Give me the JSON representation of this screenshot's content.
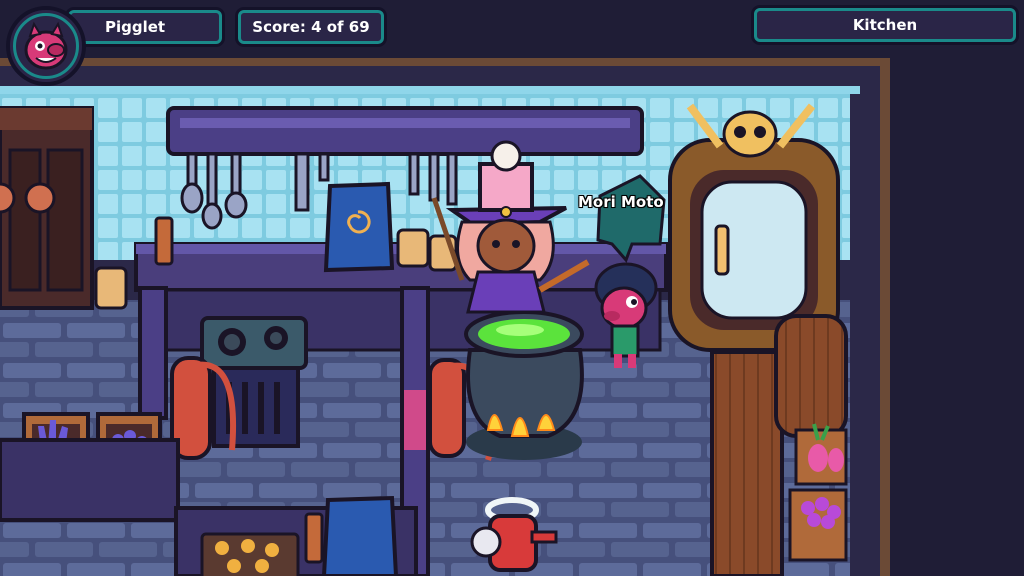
{
  "hud": {
    "player_name": "Pigglet",
    "score": "Score: 4 of 69",
    "location": "Kitchen"
  },
  "characters": {
    "npc_name": "Mori Moto"
  },
  "colors": {
    "hud_border": "#1a8a8a",
    "hud_fill": "#2a2547",
    "potion_green": "#5be33c",
    "wall_tile": "#9fdcef",
    "floor_stone": "#5d6b9a"
  },
  "icons": {
    "avatar": "pig-face-icon",
    "chat_bubble": "speech-bubble-icon"
  }
}
